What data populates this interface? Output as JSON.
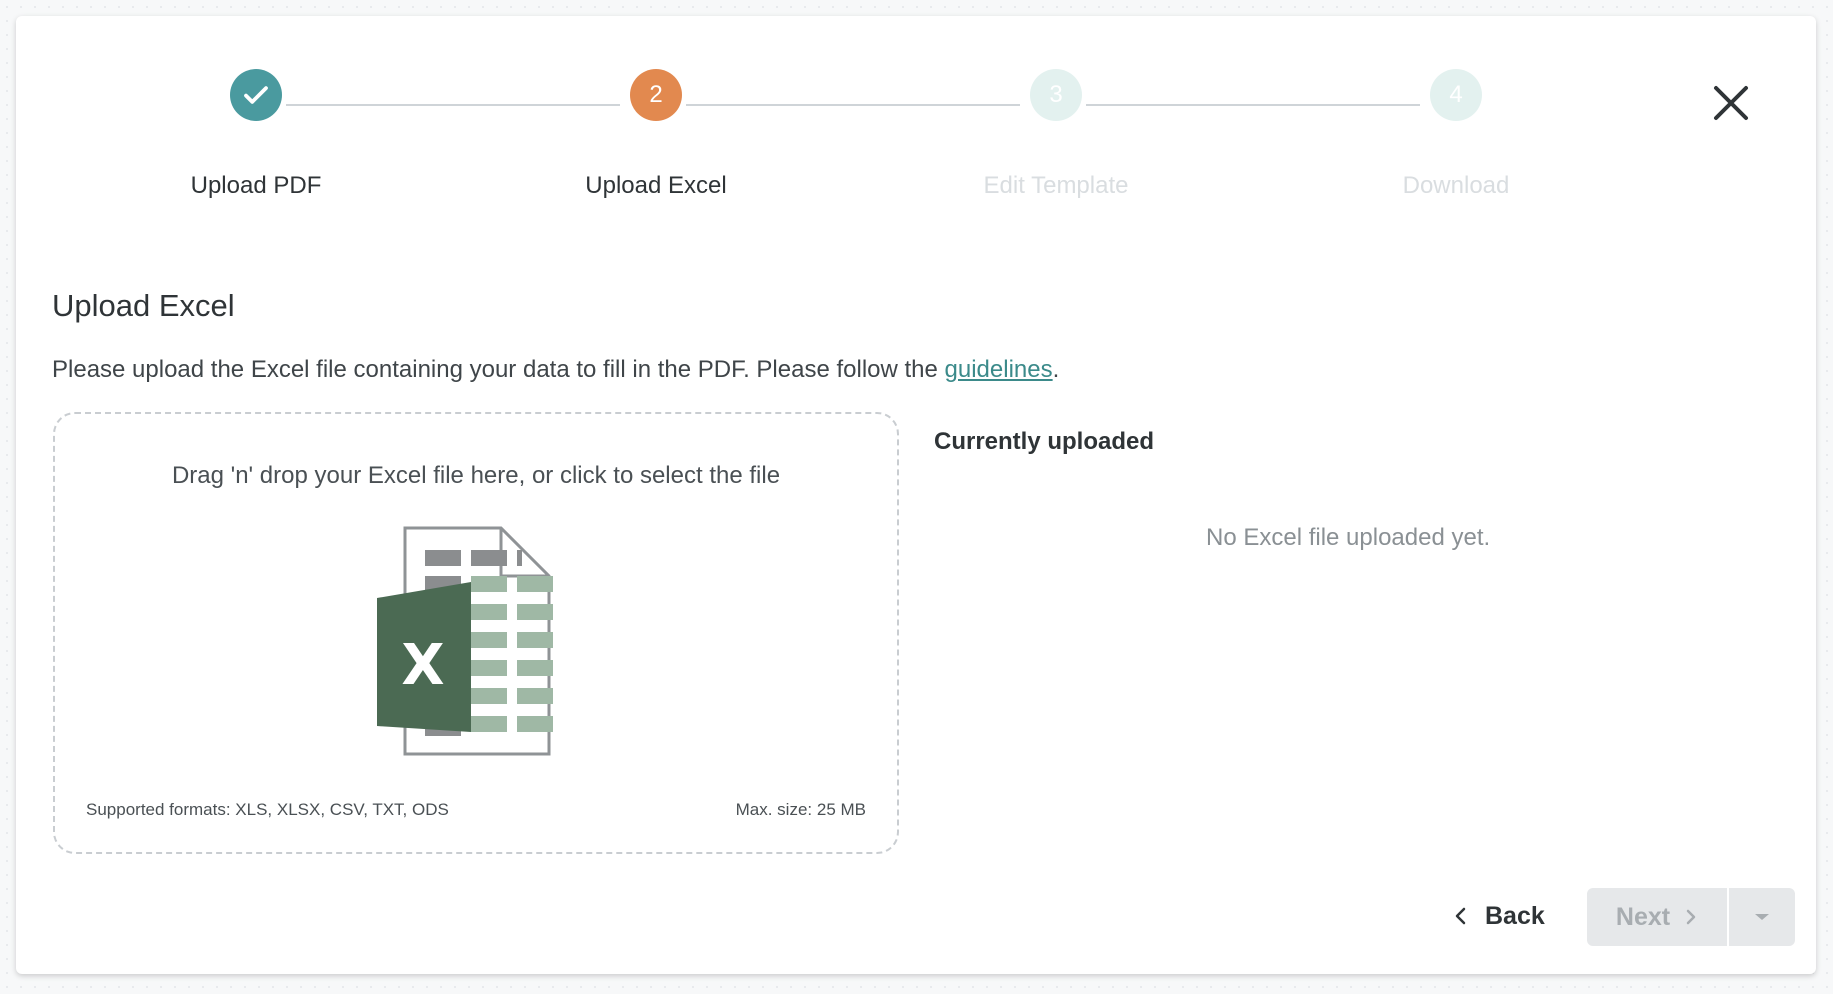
{
  "stepper": {
    "steps": [
      {
        "label": "Upload PDF",
        "number": "1",
        "state": "completed"
      },
      {
        "label": "Upload Excel",
        "number": "2",
        "state": "active"
      },
      {
        "label": "Edit Template",
        "number": "3",
        "state": "disabled"
      },
      {
        "label": "Download",
        "number": "4",
        "state": "disabled"
      }
    ]
  },
  "page": {
    "title": "Upload Excel",
    "description_prefix": "Please upload the Excel file containing your data to fill in the PDF. Please follow the ",
    "guidelines_link": "guidelines",
    "description_suffix": "."
  },
  "dropzone": {
    "prompt": "Drag 'n' drop your Excel file here, or click to select the file",
    "icon": "excel-file-icon",
    "supported_formats": "Supported formats: XLS, XLSX, CSV, TXT, ODS",
    "max_size": "Max. size: 25 MB"
  },
  "uploaded": {
    "title": "Currently uploaded",
    "empty_text": "No Excel file uploaded yet."
  },
  "footer": {
    "back_label": "Back",
    "next_label": "Next"
  },
  "colors": {
    "completed": "#4a9a9f",
    "active": "#e2894f",
    "disabled": "#e3f1ef",
    "link": "#3b8a8a",
    "excel_green": "#4b6a53"
  },
  "icons": [
    "check-icon",
    "close-icon",
    "chevron-left-icon",
    "chevron-right-icon",
    "caret-down-icon"
  ]
}
